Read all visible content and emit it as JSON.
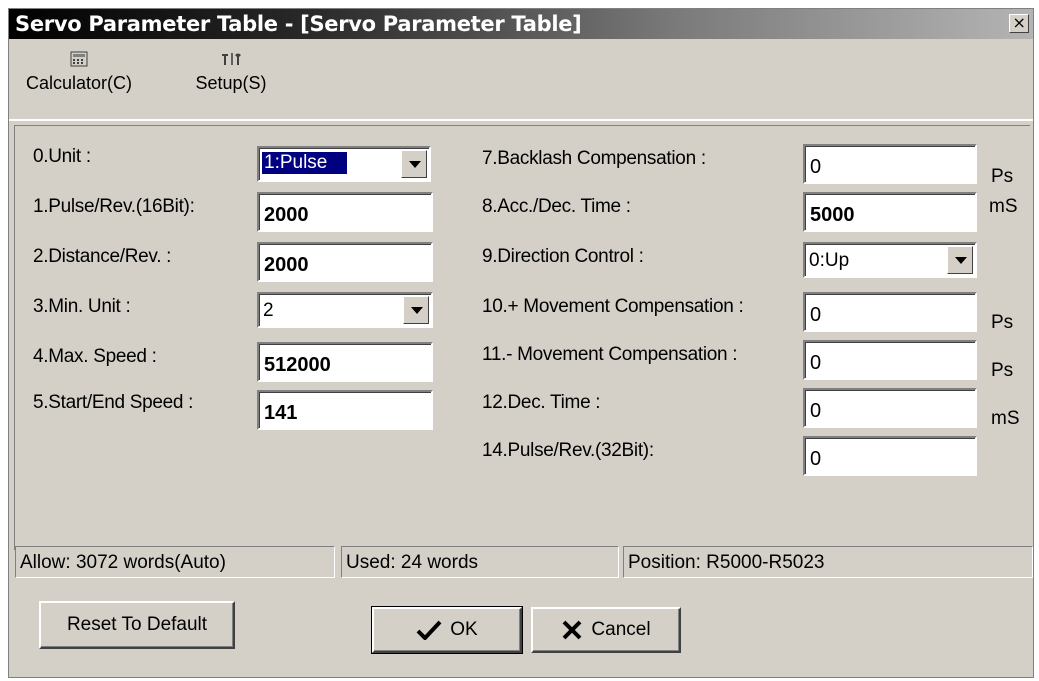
{
  "window": {
    "title": "Servo Parameter Table - [Servo Parameter Table]",
    "close_glyph": "×"
  },
  "toolbar": {
    "calculator": {
      "label": "Calculator(C)",
      "icon": "calculator-icon"
    },
    "setup": {
      "label": "Setup(S)",
      "icon": "tools-icon"
    }
  },
  "params_left": [
    {
      "label": "0.Unit :",
      "value": "1:Pulse",
      "type": "combo"
    },
    {
      "label": "1.Pulse/Rev.(16Bit):",
      "value": "2000",
      "type": "text"
    },
    {
      "label": "2.Distance/Rev. :",
      "value": "2000",
      "type": "text"
    },
    {
      "label": "3.Min. Unit :",
      "value": "2",
      "type": "combo"
    },
    {
      "label": "4.Max. Speed :",
      "value": "512000",
      "type": "text"
    },
    {
      "label": "5.Start/End Speed :",
      "value": "141",
      "type": "text"
    }
  ],
  "params_right": [
    {
      "label": "7.Backlash Compensation :",
      "value": "0",
      "unit": "Ps",
      "type": "text"
    },
    {
      "label": "8.Acc./Dec. Time :",
      "value": "5000",
      "unit": "mS",
      "type": "text"
    },
    {
      "label": "9.Direction Control :",
      "value": "0:Up",
      "unit": "",
      "type": "combo"
    },
    {
      "label": "10.+ Movement Compensation :",
      "value": "0",
      "unit": "Ps",
      "type": "text"
    },
    {
      "label": "11.- Movement Compensation :",
      "value": "0",
      "unit": "Ps",
      "type": "text"
    },
    {
      "label": "12.Dec. Time :",
      "value": "0",
      "unit": "mS",
      "type": "text"
    },
    {
      "label": "14.Pulse/Rev.(32Bit):",
      "value": "0",
      "unit": "",
      "type": "text"
    }
  ],
  "status": {
    "allow": "Allow: 3072 words(Auto)",
    "used": "Used: 24 words",
    "position": "Position: R5000-R5023"
  },
  "buttons": {
    "reset": "Reset To Default",
    "ok": "OK",
    "cancel": "Cancel"
  }
}
